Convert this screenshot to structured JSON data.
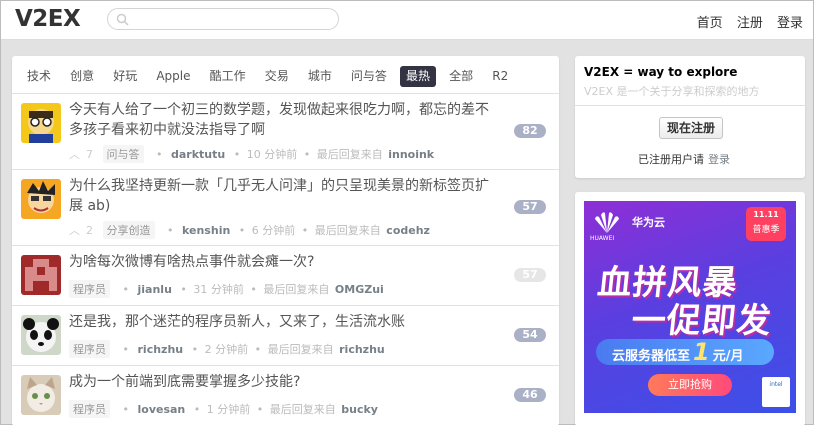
{
  "header": {
    "logo": "V2EX",
    "search_placeholder": "",
    "nav": [
      "首页",
      "注册",
      "登录"
    ]
  },
  "tabs": [
    {
      "label": "技术",
      "active": false
    },
    {
      "label": "创意",
      "active": false
    },
    {
      "label": "好玩",
      "active": false
    },
    {
      "label": "Apple",
      "active": false
    },
    {
      "label": "酷工作",
      "active": false
    },
    {
      "label": "交易",
      "active": false
    },
    {
      "label": "城市",
      "active": false
    },
    {
      "label": "问与答",
      "active": false
    },
    {
      "label": "最热",
      "active": true
    },
    {
      "label": "全部",
      "active": false
    },
    {
      "label": "R2",
      "active": false
    }
  ],
  "topics": [
    {
      "title": "今天有人给了一个初三的数学题，发现做起来很吃力啊，都忘的差不多孩子看来初中就没法指导了啊",
      "votes": "7",
      "node": "问与答",
      "author": "darktutu",
      "time": "10 分钟前",
      "last_reply_label": "最后回复来自",
      "last_reply_user": "innoink",
      "replies": "82"
    },
    {
      "title": "为什么我坚持更新一款「几乎无人问津」的只呈现美景的新标签页扩展 ab)",
      "votes": "2",
      "node": "分享创造",
      "author": "kenshin",
      "time": "6 分钟前",
      "last_reply_label": "最后回复来自",
      "last_reply_user": "codehz",
      "replies": "57"
    },
    {
      "title": "为啥每次微博有啥热点事件就会瘫一次?",
      "votes": "",
      "node": "程序员",
      "author": "jianlu",
      "time": "31 分钟前",
      "last_reply_label": "最后回复来自",
      "last_reply_user": "OMGZui",
      "replies": "57"
    },
    {
      "title": "还是我，那个迷茫的程序员新人，又来了，生活流水账",
      "votes": "",
      "node": "程序员",
      "author": "richzhu",
      "time": "2 分钟前",
      "last_reply_label": "最后回复来自",
      "last_reply_user": "richzhu",
      "replies": "54"
    },
    {
      "title": "成为一个前端到底需要掌握多少技能?",
      "votes": "",
      "node": "程序员",
      "author": "lovesan",
      "time": "1 分钟前",
      "last_reply_label": "最后回复来自",
      "last_reply_user": "bucky",
      "replies": "46"
    }
  ],
  "sidebar": {
    "tagline": "V2EX = way to explore",
    "description": "V2EX 是一个关于分享和探索的地方",
    "register_button": "现在注册",
    "registered_prompt": "已注册用户请",
    "login_link": "登录"
  },
  "ad": {
    "brand_en": "HUAWEI",
    "cloud_label": "华为云",
    "badge_top": "11.11",
    "badge_bottom": "普惠季",
    "headline_1": "血拼风暴",
    "headline_2": "一促即发",
    "strip_prefix": "云服务器低至",
    "strip_price": "1",
    "strip_suffix": "元/月",
    "buy_button": "立即抢购",
    "chip_label": "intel"
  }
}
